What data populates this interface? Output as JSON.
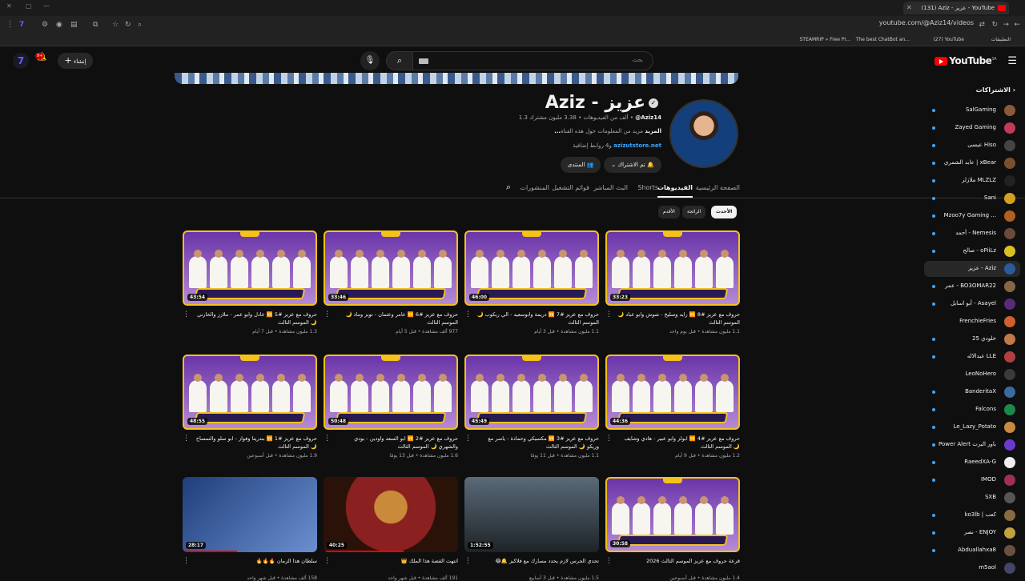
{
  "browser": {
    "tab_title": "(131) Aziz - عزيز - YouTube",
    "url": "youtube.com/@Aziz14/videos",
    "bookmarks": [
      "التطبيقات",
      "(27) YouTube",
      "The best ChatBot an...",
      "STEAMRIP » Free Pr..."
    ]
  },
  "header": {
    "logo_text": "YouTube",
    "logo_region": "SA",
    "search_placeholder": "بحث",
    "create_label": "إنشاء",
    "notif_count": "9+"
  },
  "channel": {
    "name": "Aziz - عزيز",
    "handle": "@Aziz14",
    "subscribers": "3.38 مليون مشترك",
    "video_count": "1.3 ألف من الفيديوهات",
    "description": "مزيد من المعلومات حول هذه القناة",
    "more": "...المزيد",
    "link": "azizutstore.net",
    "link_extra": "و4 روابط إضافية",
    "subscribed_label": "تم الاشتراك",
    "join_label": "المنتدى"
  },
  "tabs": [
    "الصفحة الرئيسية",
    "الفيديوهات",
    "Shorts",
    "البث المباشر",
    "قوائم التشغيل",
    "المنشورات"
  ],
  "chips": [
    "الأحدث",
    "الرائجة",
    "الأقدم"
  ],
  "videos": [
    {
      "title": "حروف مع عزيز #8 🆚 رايد وسليخ - شوش وابو عباد 🌙 الموسم الثالث",
      "meta": "1.1 مليون مشاهدة • قبل يوم واحد",
      "duration": "33:23"
    },
    {
      "title": "حروف مع عزيز #7 🆚 دريمة وابوسعيد - الي ريكوب 🌙 الموسم الثالث",
      "meta": "1.1 مليون مشاهدة • قبل 3 أيام",
      "duration": "46:00"
    },
    {
      "title": "حروف مع عزيز #6 🆚 عامر وعثمان - تويز وماذ 🌙 الموسم الثالث",
      "meta": "977 ألف مشاهدة • قبل 5 أيام",
      "duration": "33:46"
    },
    {
      "title": "حروف مع عزيز #5 🆚 عادل وابو عمر - ملازز والخارني 🌙 الموسم الثالث",
      "meta": "1.3 مليون مشاهدة • قبل 7 أيام",
      "duration": "43:54"
    },
    {
      "title": "حروف مع عزيز #4 🆚 ابولز وابو عبير - هادي وشايف 🌙 الموسم الثالث",
      "meta": "1.2 مليون مشاهدة • قبل 9 أيام",
      "duration": "44:36"
    },
    {
      "title": "حروف مع عزيز #3 🆚 مكسيكي وحمادة - ياسر مع وريكو 🌙 الموسم الثالث",
      "meta": "1.1 مليون مشاهدة • قبل 11 يومًا",
      "duration": "45:49"
    },
    {
      "title": "حروف مع عزيز #2 🆚 ابو السعد واودين - بودي والشهري 🌙 الموسم الثالث",
      "meta": "1.6 مليون مشاهدة • قبل 13 يومًا",
      "duration": "50:48"
    },
    {
      "title": "حروف مع عزيز #1 🆚 بندريتا وفواز - ابو سلو والتمساح 🌙 الموسم الثالث",
      "meta": "1.9 مليون مشاهدة • قبل أسبوعين",
      "duration": "48:55"
    },
    {
      "title": "قرعة حروف مع عزيز الموسم الثالث 2026",
      "meta": "1.4 مليون مشاهدة • قبل أسبوعين",
      "duration": "30:58"
    },
    {
      "title": "تحدي الجرس لازم يحدد مسارك مع فلاكيز 🔔😂",
      "meta": "1.5 مليون مشاهدة • قبل 3 أسابيع",
      "duration": "1:52:55"
    },
    {
      "title": "انتهت القصة هذا الملك 👑",
      "meta": "191 ألف مشاهدة • قبل شهر واحد",
      "duration": "40:25"
    },
    {
      "title": "سلطان هذا الزمان 🔥🔥🔥",
      "meta": "158 ألف مشاهدة • قبل شهر واحد",
      "duration": "28:17"
    }
  ],
  "sidebar": {
    "heading": "الاشتراكات",
    "items": [
      {
        "name": "SalGaming",
        "color": "#8a5a3a"
      },
      {
        "name": "Zayed Gaming",
        "color": "#c23a5a"
      },
      {
        "name": "عيسى Hiso",
        "color": "#444444"
      },
      {
        "name": "عابد الشمري | xBear",
        "color": "#7a5030"
      },
      {
        "name": "ملازلز MLZLZ",
        "color": "#222222"
      },
      {
        "name": "Sani",
        "color": "#d4a020"
      },
      {
        "name": "Mzoo7y Gaming ...",
        "color": "#b06020"
      },
      {
        "name": "أحمد - Nemesis",
        "color": "#6a4a3a"
      },
      {
        "name": "صالح - oPiiLz",
        "color": "#d8c020"
      },
      {
        "name": "عزيز - Aziz",
        "color": "#2a5a9a"
      },
      {
        "name": "عمر - BO3OMAR22",
        "color": "#886644"
      },
      {
        "name": "أبو اسايل - Asayel",
        "color": "#5a2a7a"
      },
      {
        "name": "FrenchieFries",
        "color": "#d06030"
      },
      {
        "name": "خلودي 25",
        "color": "#c07a4a"
      },
      {
        "name": "عبدالاله LLE",
        "color": "#b04040"
      },
      {
        "name": "LeoNoHero",
        "color": "#3a3a3a"
      },
      {
        "name": "BanderitaX",
        "color": "#3a6aa0"
      },
      {
        "name": "Falcons",
        "color": "#1a8a4a"
      },
      {
        "name": "Le_Lazy_Potato",
        "color": "#c88a40"
      },
      {
        "name": "Power Alert باور اليرت",
        "color": "#6a3ad0"
      },
      {
        "name": "RaeedXA-G",
        "color": "#eeeeee"
      },
      {
        "name": "IMOD",
        "color": "#a03050"
      },
      {
        "name": "SXB",
        "color": "#555555"
      },
      {
        "name": "ko3lb | كعب",
        "color": "#8a6a40"
      },
      {
        "name": "نصر - ENJOY",
        "color": "#c0a040"
      },
      {
        "name": "Abduallahxa8",
        "color": "#6a5040"
      },
      {
        "name": "m5aol",
        "color": "#444466"
      }
    ]
  }
}
